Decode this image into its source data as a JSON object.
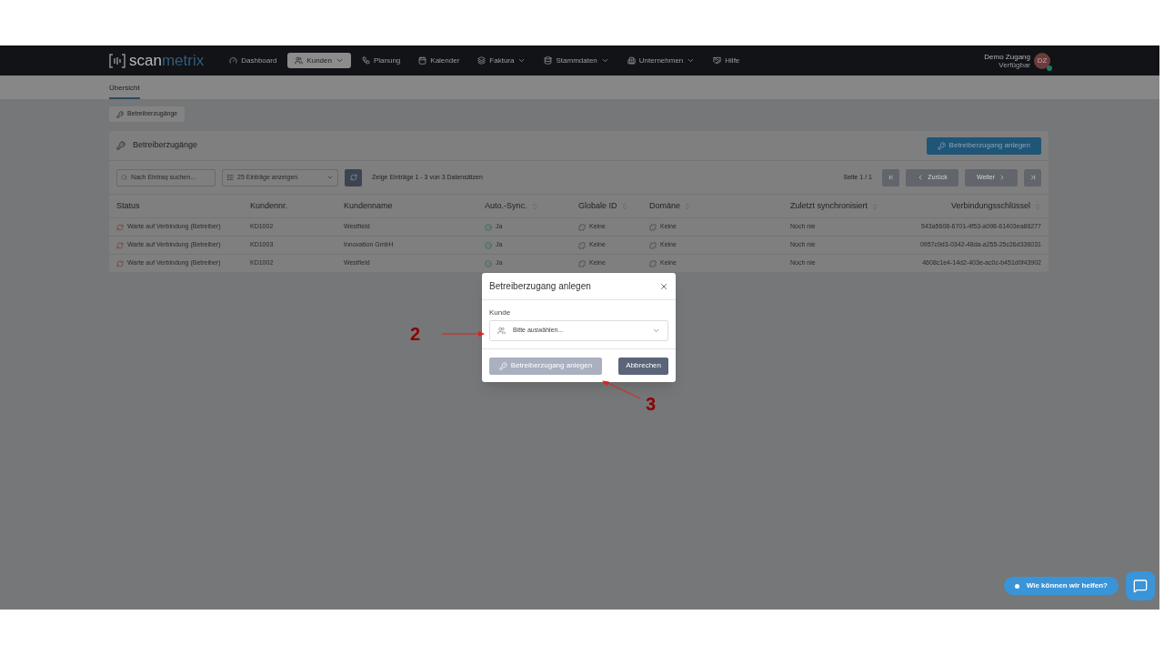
{
  "navbar": {
    "logo": {
      "part_1": "scan",
      "part_2": "metrix"
    },
    "items": [
      {
        "label": "Dashboard",
        "selected": false,
        "dropdown": false
      },
      {
        "label": "Kunden",
        "selected": true,
        "dropdown": true
      },
      {
        "label": "Planung",
        "selected": false,
        "dropdown": false
      },
      {
        "label": "Kalender",
        "selected": false,
        "dropdown": false
      },
      {
        "label": "Faktura",
        "selected": false,
        "dropdown": true
      },
      {
        "label": "Stammdaten",
        "selected": false,
        "dropdown": true
      },
      {
        "label": "Unternehmen",
        "selected": false,
        "dropdown": true
      },
      {
        "label": "Hilfe",
        "selected": false,
        "dropdown": false
      }
    ],
    "user": {
      "name": "Demo Zugang",
      "status": "Verfügbar",
      "initials": "DZ",
      "online": true
    }
  },
  "subnav": {
    "tabs": [
      {
        "label": "Übersicht",
        "selected": true
      }
    ]
  },
  "breadcrumb": "Betreiberzugänge",
  "card": {
    "title": "Betreiberzugänge",
    "create_button": "Betreiberzugang anlegen",
    "search": {
      "placeholder": "Nach Eintrag suchen..."
    },
    "page_size": "25 Einträge anzeigen",
    "summary": "Zeige Einträge 1 - 3 von 3 Datensätzen",
    "page": "Seite 1 / 1",
    "pagination": [
      {
        "kind": "first",
        "disabled": true
      },
      {
        "kind": "prev",
        "label": "Zurück",
        "disabled": true
      },
      {
        "kind": "next",
        "label": "Weiter",
        "disabled": true
      },
      {
        "kind": "last",
        "disabled": true
      }
    ],
    "table": {
      "columns": [
        {
          "label": "Status",
          "sortable": false
        },
        {
          "label": "Kundennr.",
          "sortable": false
        },
        {
          "label": "Kundenname",
          "sortable": false
        },
        {
          "label": "Auto.-Sync.",
          "sortable": true
        },
        {
          "label": "Globale ID",
          "sortable": true
        },
        {
          "label": "Domäne",
          "sortable": true
        },
        {
          "label": "Zuletzt synchronisiert",
          "sortable": true
        },
        {
          "label": "Verbindungsschlüssel",
          "sortable": true
        }
      ],
      "rows": [
        {
          "status": "Warte auf Verbindung (Betreiber)",
          "number": "KD1002",
          "name": "Westfield",
          "sync": "Ja",
          "global_id": "Keine",
          "domain": "Keine",
          "last_sync": "Noch nie",
          "key": "543a5608-6701-4f53-a098-61403ea86277"
        },
        {
          "status": "Warte auf Verbindung (Betreiber)",
          "number": "KD1003",
          "name": "Innovation GmbH",
          "sync": "Ja",
          "global_id": "Keine",
          "domain": "Keine",
          "last_sync": "Noch nie",
          "key": "0957c9d3-0342-48da-a255-25c26d336031"
        },
        {
          "status": "Warte auf Verbindung (Betreiber)",
          "number": "KD1002",
          "name": "Westfield",
          "sync": "Ja",
          "global_id": "Keine",
          "domain": "Keine",
          "last_sync": "Noch nie",
          "key": "4608c1e4-14d2-403e-ac0c-b451d0f43902"
        }
      ]
    }
  },
  "modal": {
    "title": "Betreiberzugang anlegen",
    "field_label": "Kunde",
    "select": {
      "placeholder": "Bitte auswählen..."
    },
    "buttons": [
      {
        "kind": "primary",
        "label": "Betreiberzugang anlegen",
        "disabled": true
      },
      {
        "kind": "secondary",
        "label": "Abbrechen",
        "disabled": false
      }
    ]
  },
  "annotations": [
    {
      "label": "2"
    },
    {
      "label": "3"
    }
  ],
  "chat": {
    "label": "Wie können wir helfen?"
  }
}
